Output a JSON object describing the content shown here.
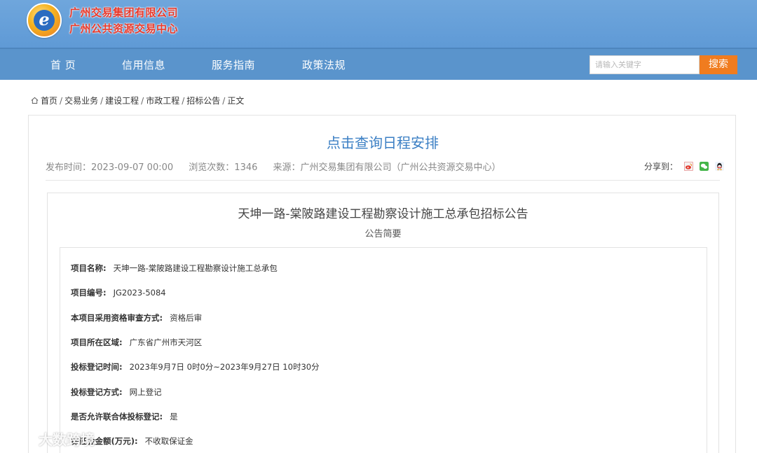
{
  "header": {
    "logo_letter": "e",
    "brand_line1": "广州交易集团有限公司",
    "brand_line2": "广州公共资源交易中心"
  },
  "nav": {
    "items": [
      {
        "label": "首 页"
      },
      {
        "label": "信用信息"
      },
      {
        "label": "服务指南"
      },
      {
        "label": "政策法规"
      }
    ],
    "search_placeholder": "请输入关键字",
    "search_button": "搜索"
  },
  "breadcrumb": {
    "items": [
      "首页",
      "交易业务",
      "建设工程",
      "市政工程",
      "招标公告",
      "正文"
    ],
    "separator": "/"
  },
  "article": {
    "title_link": "点击查询日程安排",
    "publish_time": "发布时间：2023-09-07 00:00",
    "views": "浏览次数：1346",
    "source": "来源：广州交易集团有限公司（广州公共资源交易中心）",
    "share_label": "分享到：",
    "share_icons": [
      "weibo-icon",
      "wechat-icon",
      "qq-icon"
    ]
  },
  "notice": {
    "title": "天坤一路-棠陂路建设工程勘察设计施工总承包招标公告",
    "subtitle": "公告简要",
    "rows": [
      {
        "key": "项目名称:",
        "value": "天坤一路-棠陂路建设工程勘察设计施工总承包"
      },
      {
        "key": "项目编号:",
        "value": "JG2023-5084"
      },
      {
        "key": "本项目采用资格审查方式:",
        "value": "资格后审"
      },
      {
        "key": "项目所在区域:",
        "value": "广东省广州市天河区"
      },
      {
        "key": "投标登记时间:",
        "value": "2023年9月7日 0时0分~2023年9月27日 10时30分"
      },
      {
        "key": "投标登记方式:",
        "value": "网上登记"
      },
      {
        "key": "是否允许联合体投标登记:",
        "value": "是"
      },
      {
        "key": "保证金金额(万元):",
        "value": "不收取保证金"
      }
    ]
  },
  "watermark": {
    "text": "大数跨境"
  },
  "colors": {
    "banner": "#6fa6dc",
    "nav": "#5a94cc",
    "brand_text": "#e8392b",
    "search_button": "#f07c1f",
    "title_link": "#3b7fc4"
  }
}
